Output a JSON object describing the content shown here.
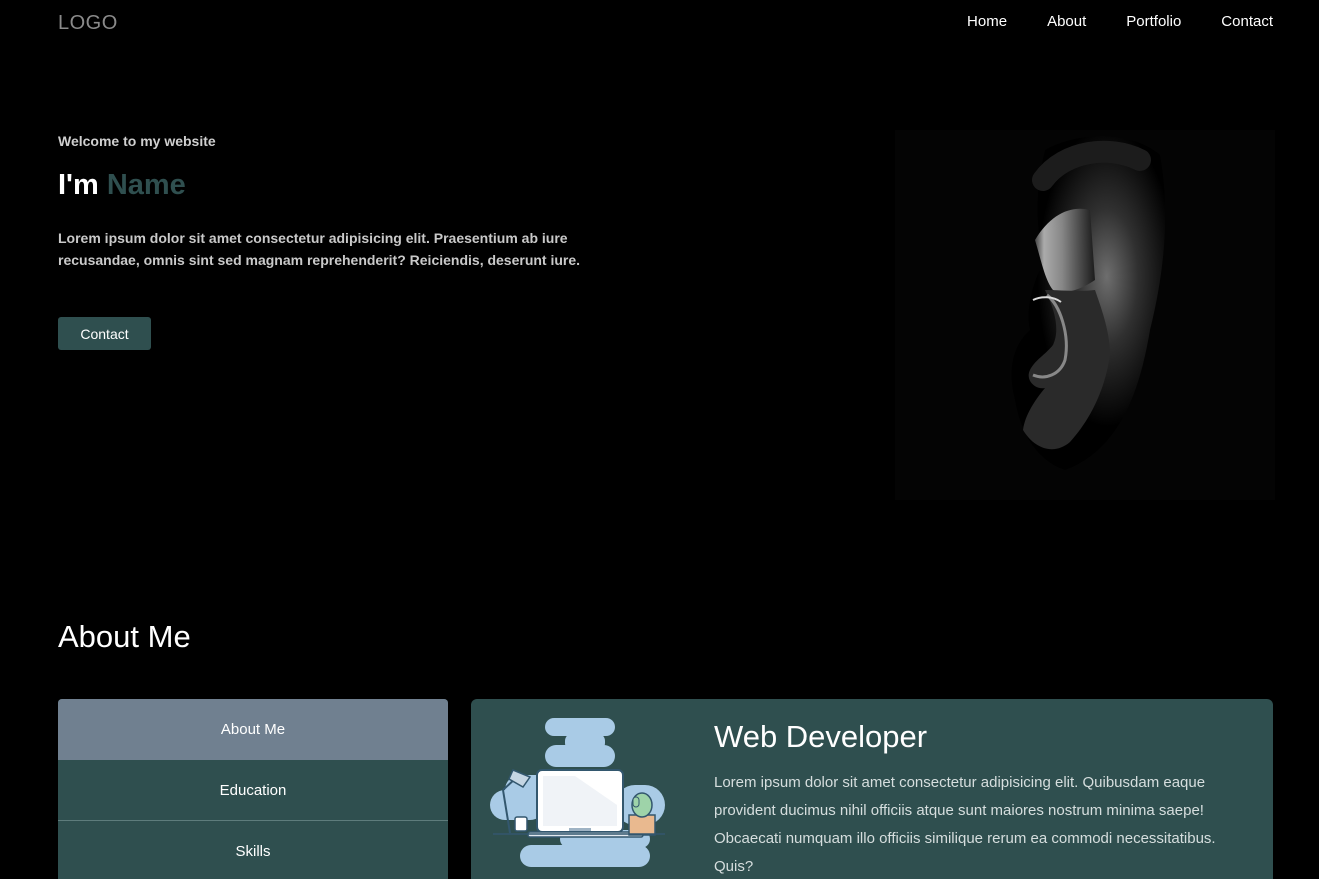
{
  "header": {
    "logo": "LOGO",
    "nav": [
      "Home",
      "About",
      "Portfolio",
      "Contact"
    ]
  },
  "hero": {
    "subtitle": "Welcome to my website",
    "title_prefix": "I'm",
    "title_name": "Name",
    "description": "Lorem ipsum dolor sit amet consectetur adipisicing elit. Praesentium ab iure recusandae, omnis sint sed magnam reprehenderit? Reiciendis, deserunt iure.",
    "button": "Contact"
  },
  "about": {
    "title": "About Me",
    "tabs": [
      "About Me",
      "Education",
      "Skills"
    ],
    "active_tab": "About Me",
    "card_title": "Web Developer",
    "card_text": "Lorem ipsum dolor sit amet consectetur adipisicing elit. Quibusdam eaque provident ducimus nihil officiis atque sunt maiores nostrum minima saepe! Obcaecati numquam illo officiis similique rerum ea commodi necessitatibus. Quis?"
  },
  "colors": {
    "accent": "#2f4f4f",
    "tab_active": "#708090",
    "background": "#000000"
  }
}
